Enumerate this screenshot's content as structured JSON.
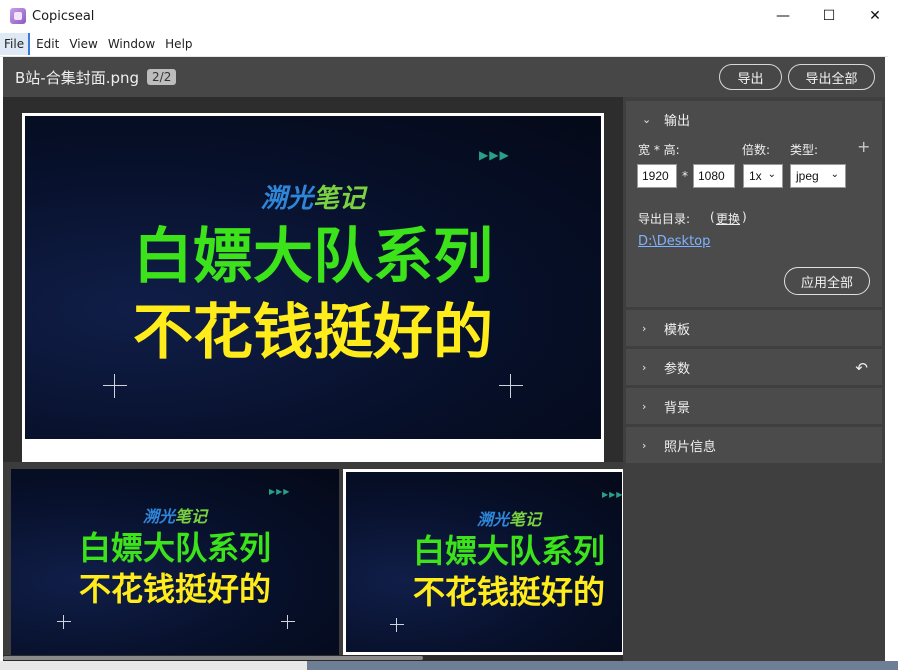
{
  "window": {
    "title": "Copicseal",
    "controls": {
      "minimize": "—",
      "maximize": "☐",
      "close": "✕"
    }
  },
  "menu": [
    "File",
    "Edit",
    "View",
    "Window",
    "Help"
  ],
  "header": {
    "file_name": "B站-合集封面.png",
    "count": "2/2",
    "export_label": "导出",
    "export_all_label": "导出全部"
  },
  "cover": {
    "brand_a": "溯光",
    "brand_b": "笔记",
    "line1": "白嫖大队系列",
    "line2": "不花钱挺好的",
    "arrows": "▶▶▶"
  },
  "panel": {
    "output": {
      "title": "输出",
      "size_label": "宽 * 高:",
      "width": "1920",
      "times": "*",
      "height": "1080",
      "scale_label": "倍数:",
      "scale": "1x",
      "type_label": "类型:",
      "type": "jpeg",
      "add": "+",
      "dir_label": "导出目录:",
      "change_open": "(",
      "change": "更换",
      "change_close": ")",
      "dir_path": "D:\\Desktop",
      "apply_all": "应用全部"
    },
    "sections": [
      {
        "title": "模板"
      },
      {
        "title": "参数"
      },
      {
        "title": "背景"
      },
      {
        "title": "照片信息"
      }
    ],
    "undo_icon": "↶"
  },
  "colors": {
    "brand_blue": "#2f86d8",
    "brand_green": "#7bd241",
    "title_green": "#3ce21a",
    "title_yellow": "#ffec1a",
    "header_bg": "#474747",
    "panel_bg": "#3f3f3f",
    "section_bg": "#4b4b4b",
    "link": "#7fb2ff"
  }
}
